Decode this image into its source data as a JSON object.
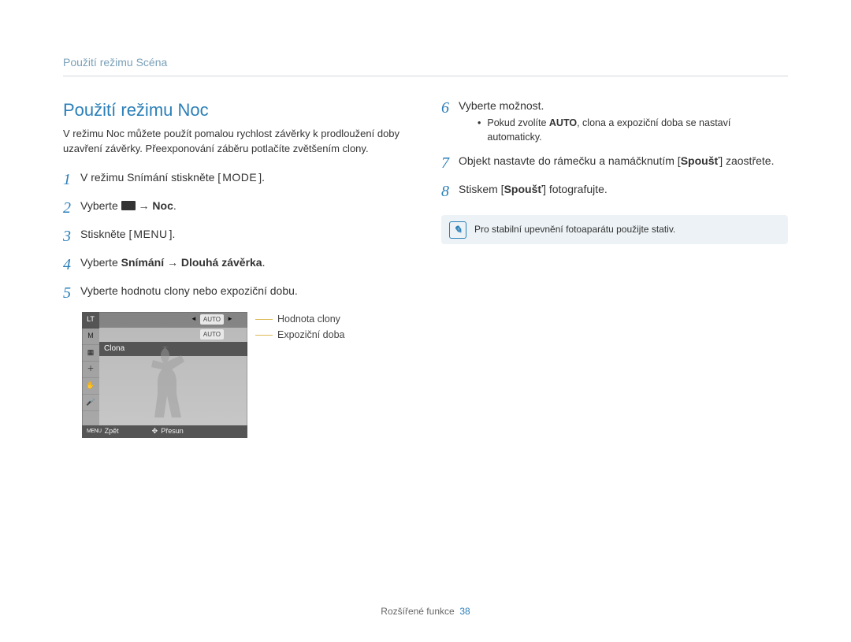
{
  "breadcrumb": "Použití režimu Scéna",
  "section_title": "Použití režimu Noc",
  "intro": "V režimu Noc můžete použít pomalou rychlost závěrky k prodloužení doby uzavření závěrky. Přeexponování záběru potlačíte zvětšením clony.",
  "left_steps": {
    "s1": {
      "num": "1",
      "prefix": "V režimu Snímání stiskněte [",
      "kbd": "MODE",
      "suffix": "]."
    },
    "s2": {
      "num": "2",
      "prefix": "Vyberte ",
      "arrow": " → ",
      "bold": "Noc",
      "suffix": "."
    },
    "s3": {
      "num": "3",
      "prefix": "Stiskněte [",
      "kbd": "MENU",
      "suffix": "]."
    },
    "s4": {
      "num": "4",
      "prefix": "Vyberte ",
      "bold1": "Snímání",
      "arrow": " → ",
      "bold2": "Dlouhá závěrka",
      "suffix": "."
    },
    "s5": {
      "num": "5",
      "text": "Vyberte hodnotu clony nebo expoziční dobu."
    }
  },
  "cam": {
    "lt": "LT",
    "m": "M",
    "auto1": "AUTO",
    "auto2": "AUTO",
    "clona": "Clona",
    "menu": "MENU",
    "back": "Zpět",
    "move": "Přesun",
    "callout1": "Hodnota clony",
    "callout2": "Expoziční doba"
  },
  "right_steps": {
    "s6": {
      "num": "6",
      "text": "Vyberte možnost.",
      "sub_prefix": "Pokud zvolíte ",
      "sub_bold": "AUTO",
      "sub_suffix": ", clona a expoziční doba se nastaví automaticky."
    },
    "s7": {
      "num": "7",
      "prefix": "Objekt nastavte do rámečku a namáčknutím [",
      "bold": "Spoušť",
      "suffix": "] zaostřete."
    },
    "s8": {
      "num": "8",
      "prefix": "Stiskem [",
      "bold": "Spoušť",
      "suffix": "] fotografujte."
    }
  },
  "note": "Pro stabilní upevnění fotoaparátu použijte stativ.",
  "footer": {
    "label": "Rozšířené funkce",
    "page": "38"
  }
}
